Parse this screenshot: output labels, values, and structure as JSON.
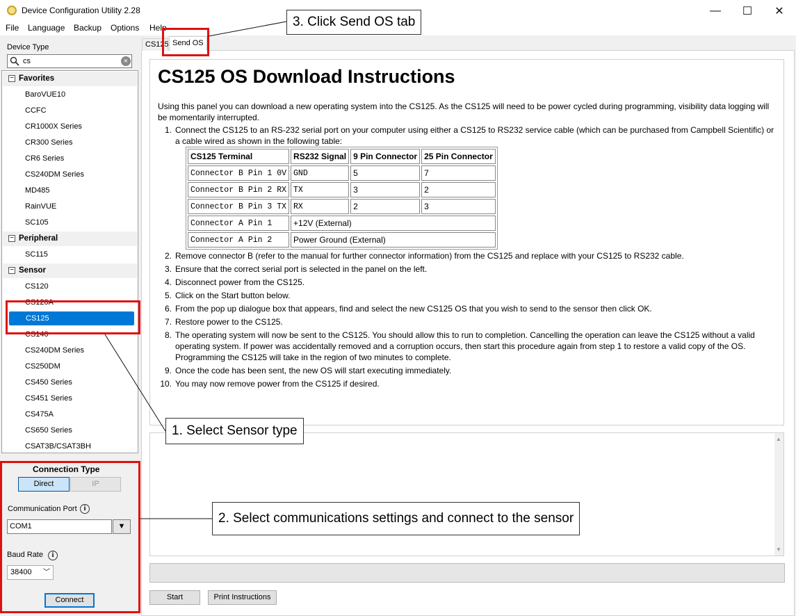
{
  "window": {
    "title": "Device Configuration Utility 2.28"
  },
  "menu": [
    "File",
    "Language",
    "Backup",
    "Options",
    "Help"
  ],
  "sidebar": {
    "device_type_label": "Device Type",
    "search_value": "cs",
    "groups": [
      {
        "label": "Favorites",
        "items": [
          "BaroVUE10",
          "CCFC",
          "CR1000X Series",
          "CR300 Series",
          "CR6 Series",
          "CS240DM Series",
          "MD485",
          "RainVUE",
          "SC105"
        ]
      },
      {
        "label": "Peripheral",
        "items": [
          "SC115"
        ]
      },
      {
        "label": "Sensor",
        "items": [
          "CS120",
          "CS120A",
          "CS125",
          "CS140",
          "CS240DM Series",
          "CS250DM",
          "CS450 Series",
          "CS451 Series",
          "CS475A",
          "CS650 Series",
          "CSAT3B/CSAT3BH"
        ]
      }
    ],
    "selected_item": "CS125"
  },
  "connection": {
    "title": "Connection Type",
    "direct_label": "Direct",
    "ip_label": "IP",
    "comport_label": "Communication Port",
    "comport_value": "COM1",
    "baud_label": "Baud Rate",
    "baud_value": "38400",
    "connect_label": "Connect",
    "info_glyph": "i"
  },
  "tabs": [
    {
      "label": "CS125"
    },
    {
      "label": "Send OS"
    }
  ],
  "doc": {
    "heading": "CS125 OS Download Instructions",
    "intro": "Using this panel you can download a new operating system into the CS125. As the CS125 will need to be power cycled during programming, visibility data logging will be momentarily interrupted.",
    "steps": [
      "Connect the CS125 to an RS-232 serial port on your computer using either a CS125 to RS232 service cable (which can be purchased from Campbell Scientific) or a cable wired as shown in the following table:",
      "Remove connector B (refer to the manual for further connector information) from the CS125 and replace with your CS125 to RS232 cable.",
      "Ensure that the correct serial port is selected in the panel on the left.",
      "Disconnect power from the CS125.",
      "Click on the Start button below.",
      "From the pop up dialogue box that appears, find and select the new CS125 OS that you wish to send to the sensor then click OK.",
      "Restore power to the CS125.",
      "The operating system will now be sent to the CS125. You should allow this to run to completion. Cancelling the operation can leave the CS125 without a valid operating system. If power was accidentally removed and a corruption occurs, then start this procedure again from step 1 to restore a valid copy of the OS. Programming the CS125 will take in the region of two minutes to complete.",
      "Once the code has been sent, the new OS will start executing immediately.",
      "You may now remove power from the CS125 if desired."
    ],
    "table": {
      "headers": [
        "CS125 Terminal",
        "RS232 Signal",
        "9 Pin Connector",
        "25 Pin Connector"
      ],
      "rows": [
        [
          "Connector B Pin 1 0V",
          "GND",
          "5",
          "7"
        ],
        [
          "Connector B Pin 2 RX",
          "TX",
          "3",
          "2"
        ],
        [
          "Connector B Pin 3 TX",
          "RX",
          "2",
          "3"
        ],
        [
          "Connector A Pin 1",
          "+12V (External)"
        ],
        [
          "Connector A Pin 2",
          "Power Ground (External)"
        ]
      ]
    }
  },
  "buttons": {
    "start": "Start",
    "print": "Print Instructions"
  },
  "callouts": {
    "step1": "1. Select Sensor type",
    "step2": "2. Select communications settings and connect to the sensor",
    "step3": "3. Click Send OS tab"
  },
  "colors": {
    "selection": "#0078d7",
    "annotation": "#e01010"
  }
}
